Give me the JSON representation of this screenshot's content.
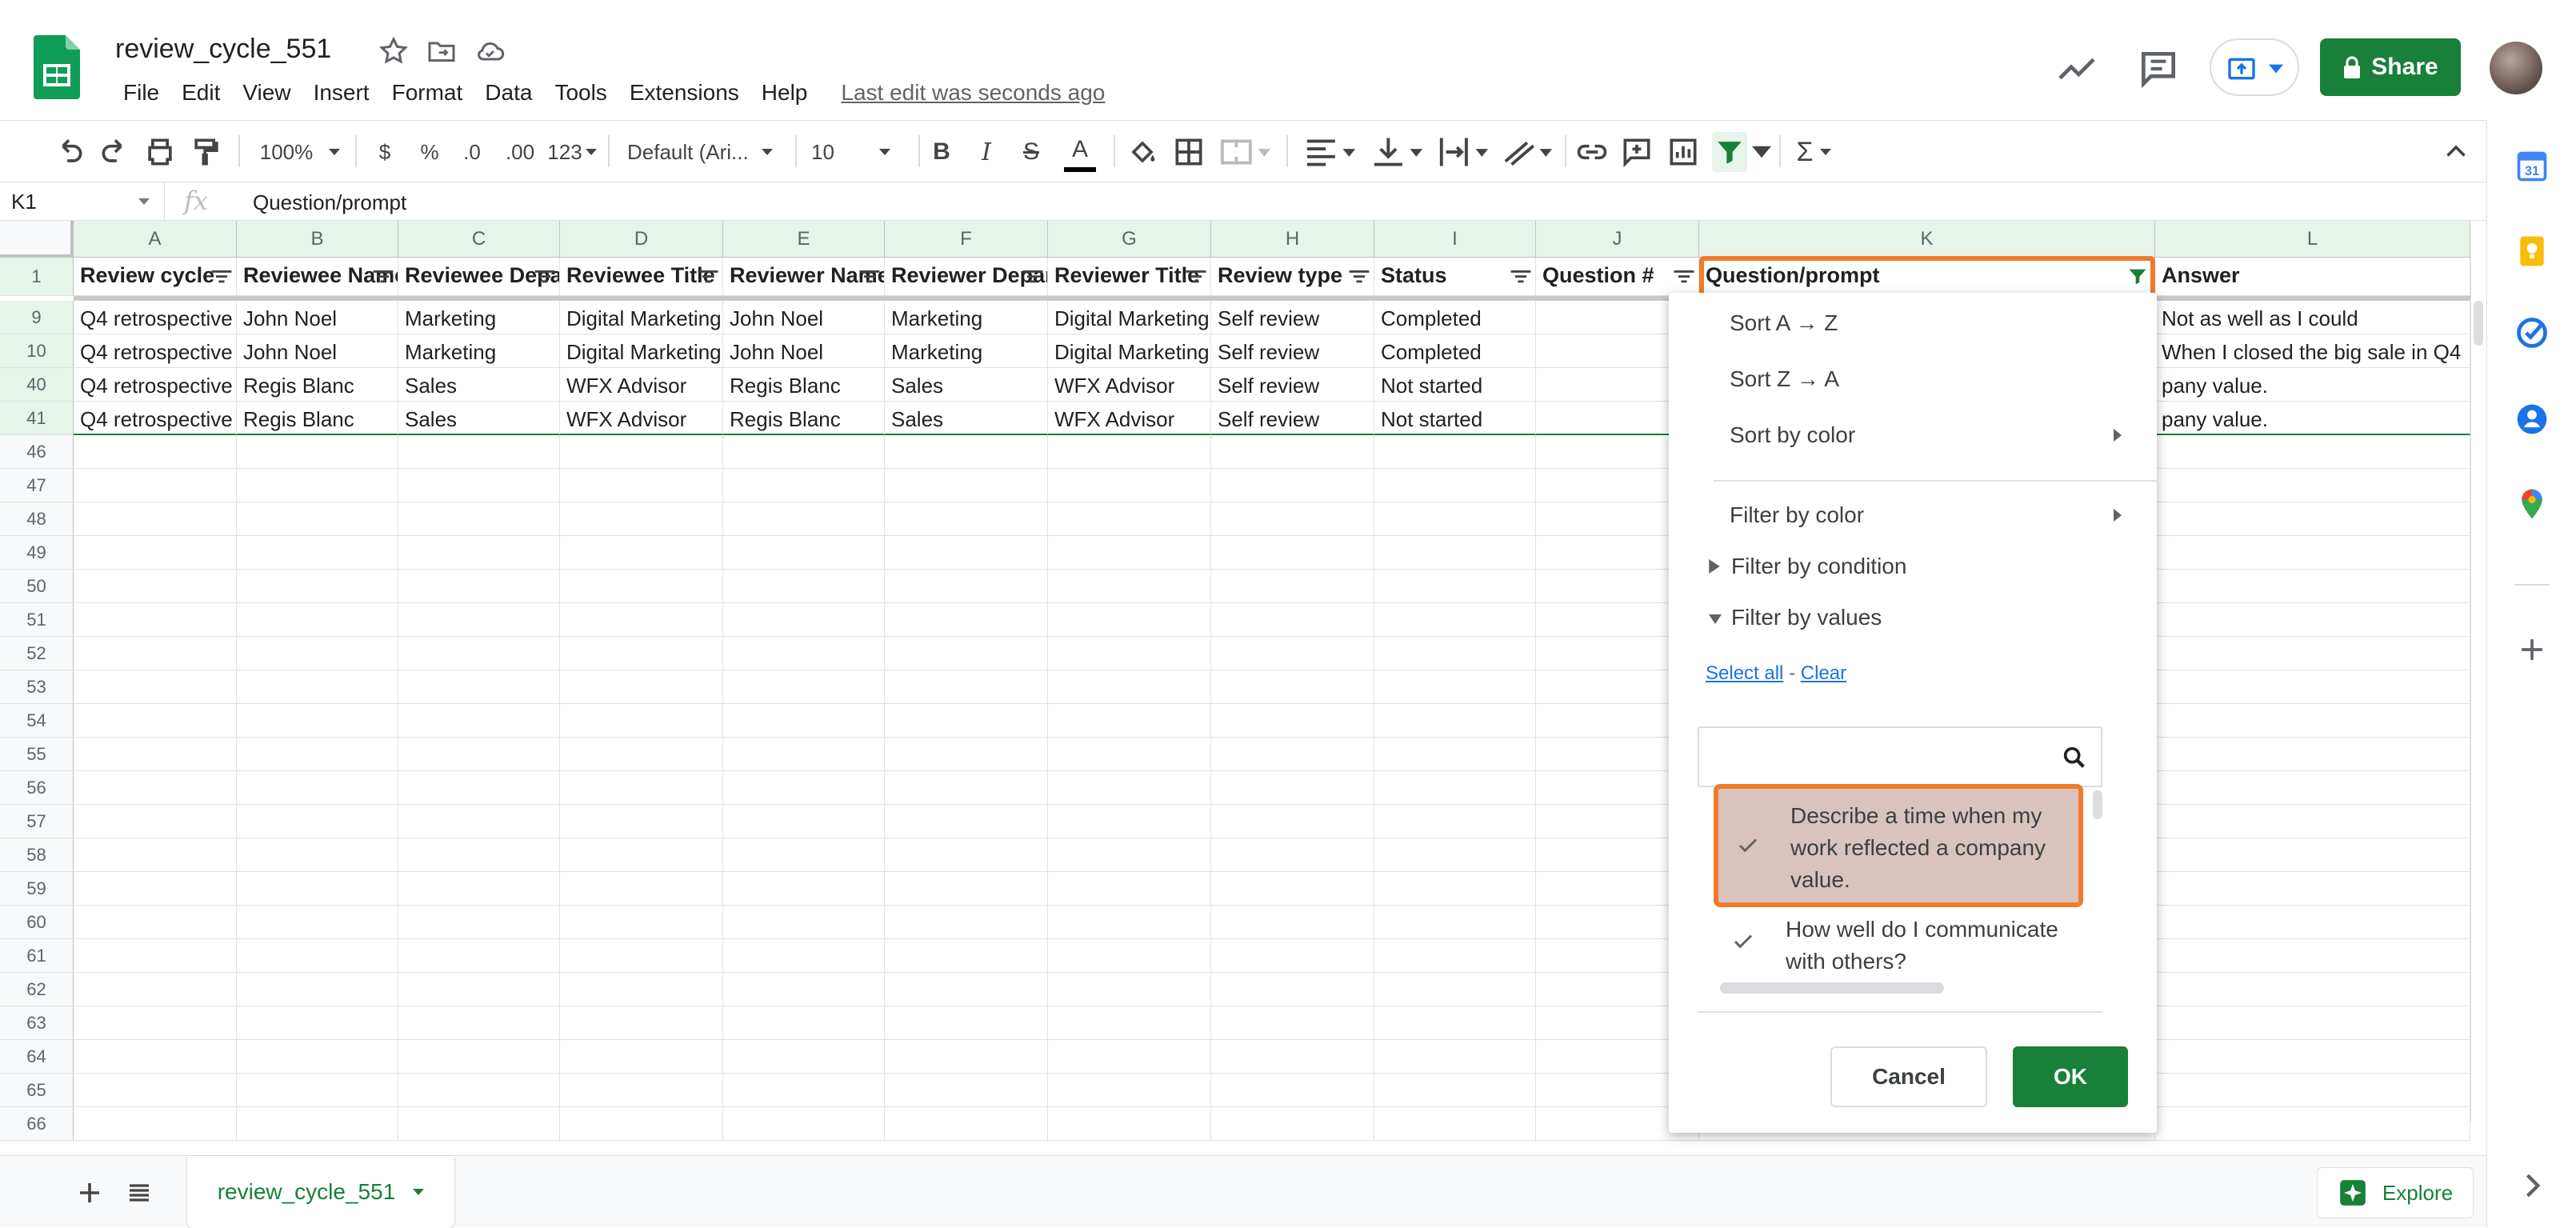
{
  "app": {
    "doc_title": "review_cycle_551",
    "last_edit": "Last edit was seconds ago",
    "share_label": "Share",
    "menu": [
      "File",
      "Edit",
      "View",
      "Insert",
      "Format",
      "Data",
      "Tools",
      "Extensions",
      "Help"
    ]
  },
  "toolbar": {
    "zoom": "100%",
    "currency": "$",
    "percent": "%",
    "decrease_decimals": ".0",
    "increase_decimals": ".00",
    "more_formats": "123",
    "font": "Default (Ari...",
    "font_size": "10",
    "bold": "B",
    "italic": "I",
    "strikethrough": "S",
    "text_color": "A",
    "sum_symbol": "Σ"
  },
  "formula_bar": {
    "cell_ref": "K1",
    "fx": "fx",
    "content": "Question/prompt"
  },
  "sheet": {
    "columns": [
      "A",
      "B",
      "C",
      "D",
      "E",
      "F",
      "G",
      "H",
      "I",
      "J",
      "K",
      "L"
    ],
    "headers": [
      "Review cycle",
      "Reviewee Name",
      "Reviewee Department",
      "Reviewee Title",
      "Reviewer Name",
      "Reviewer Department",
      "Reviewer Title",
      "Review type",
      "Status",
      "Question #",
      "Question/prompt",
      "Answer"
    ],
    "data_rows": [
      {
        "num": "9",
        "cells": [
          "Q4 retrospective",
          "John Noel",
          "Marketing",
          "Digital Marketing",
          "John Noel",
          "Marketing",
          "Digital Marketing",
          "Self review",
          "Completed",
          "",
          "",
          "Not as well as I could"
        ]
      },
      {
        "num": "10",
        "cells": [
          "Q4 retrospective",
          "John Noel",
          "Marketing",
          "Digital Marketing",
          "John Noel",
          "Marketing",
          "Digital Marketing",
          "Self review",
          "Completed",
          "",
          "",
          "When I closed the big sale in Q4"
        ]
      },
      {
        "num": "40",
        "cells": [
          "Q4 retrospective",
          "Regis Blanc",
          "Sales",
          "WFX Advisor",
          "Regis Blanc",
          "Sales",
          "WFX Advisor",
          "Self review",
          "Not started",
          "",
          "",
          "pany value."
        ]
      },
      {
        "num": "41",
        "cells": [
          "Q4 retrospective",
          "Regis Blanc",
          "Sales",
          "WFX Advisor",
          "Regis Blanc",
          "Sales",
          "WFX Advisor",
          "Self review",
          "Not started",
          "",
          "",
          "pany value."
        ]
      }
    ],
    "empty_rows": [
      "46",
      "47",
      "48",
      "49",
      "50",
      "51",
      "52",
      "53",
      "54",
      "55",
      "56",
      "57",
      "58",
      "59",
      "60",
      "61",
      "62",
      "63",
      "64",
      "65",
      "66"
    ],
    "header_row_num": "1"
  },
  "filter_panel": {
    "sort_az": "Sort A → Z",
    "sort_za": "Sort Z → A",
    "sort_by_color": "Sort by color",
    "filter_by_color": "Filter by color",
    "filter_by_condition": "Filter by condition",
    "filter_by_values": "Filter by values",
    "select_all": "Select all",
    "separator": "-",
    "clear": "Clear",
    "search_value": "",
    "values": [
      {
        "label": "Describe a time when my work reflected a company value.",
        "checked": true
      },
      {
        "label": "How well do I communicate with others?",
        "checked": true
      }
    ],
    "cancel_label": "Cancel",
    "ok_label": "OK"
  },
  "bottom": {
    "sheet_tab": "review_cycle_551",
    "explore_label": "Explore"
  },
  "colors": {
    "accent_green": "#188038",
    "highlight_orange": "#f07b2a",
    "selected_value_bg": "#d9c3bc",
    "filter_header_bg": "#e6f4ea"
  }
}
